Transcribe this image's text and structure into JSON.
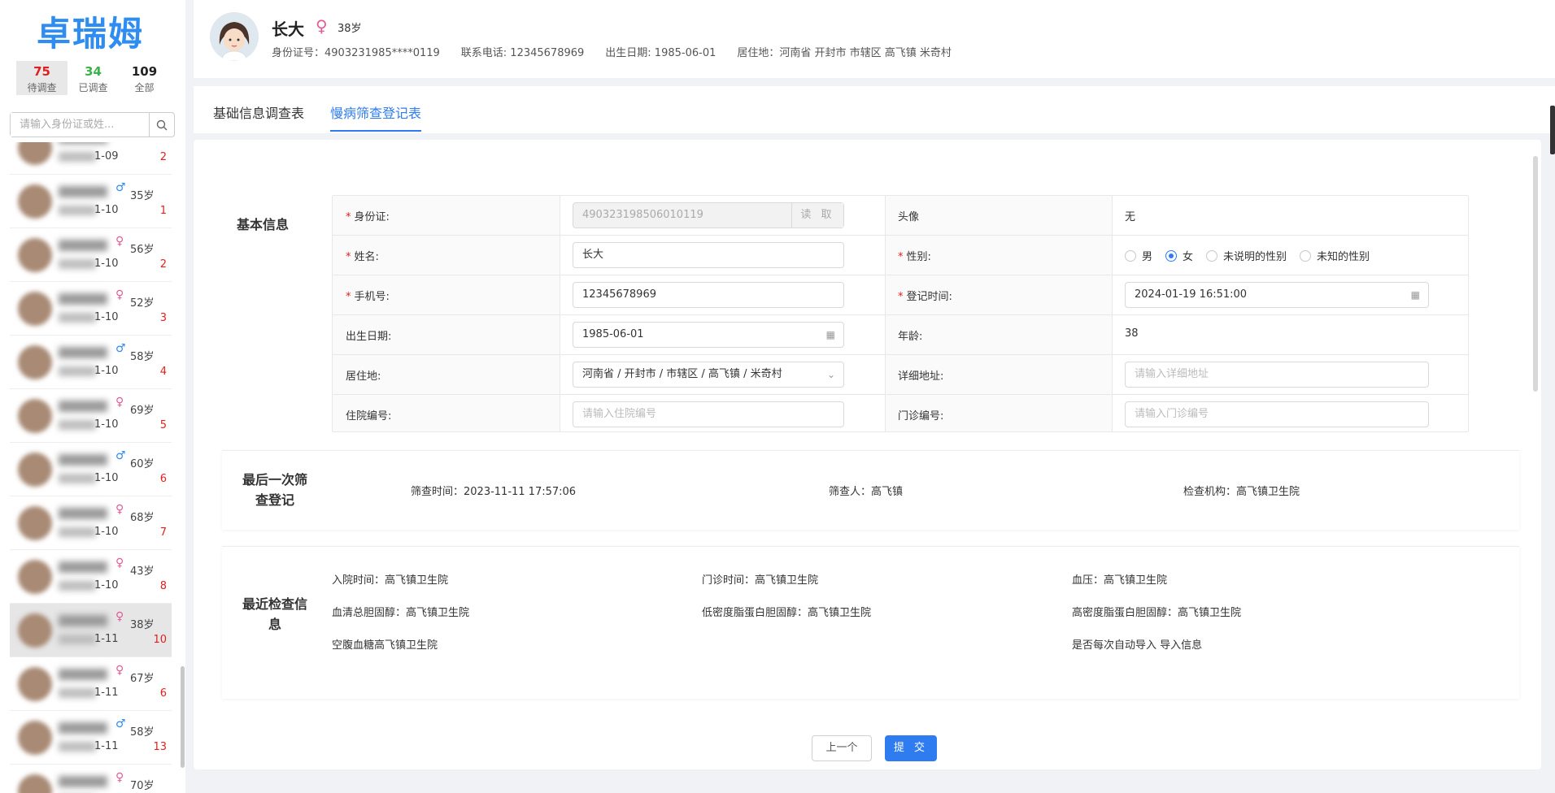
{
  "app": {
    "logo": "卓瑞姆"
  },
  "stats": [
    {
      "num": "75",
      "label": "待调查",
      "color": "#e02020"
    },
    {
      "num": "34",
      "label": "已调查",
      "color": "#3cb34a"
    },
    {
      "num": "109",
      "label": "全部",
      "color": "#222222"
    }
  ],
  "search": {
    "placeholder": "请输入身份证或姓..."
  },
  "people": [
    {
      "date": "1-09",
      "gender": "",
      "age": "",
      "count": "2"
    },
    {
      "date": "1-10",
      "gender": "♂",
      "age": "35岁",
      "count": "1"
    },
    {
      "date": "1-10",
      "gender": "♀",
      "age": "56岁",
      "count": "2"
    },
    {
      "date": "1-10",
      "gender": "♀",
      "age": "52岁",
      "count": "3"
    },
    {
      "date": "1-10",
      "gender": "♂",
      "age": "58岁",
      "count": "4"
    },
    {
      "date": "1-10",
      "gender": "♀",
      "age": "69岁",
      "count": "5"
    },
    {
      "date": "1-10",
      "gender": "♂",
      "age": "60岁",
      "count": "6"
    },
    {
      "date": "1-10",
      "gender": "♀",
      "age": "68岁",
      "count": "7"
    },
    {
      "date": "1-10",
      "gender": "♀",
      "age": "43岁",
      "count": "8"
    },
    {
      "date": "1-11",
      "gender": "♀",
      "age": "38岁",
      "count": "10",
      "selected": true
    },
    {
      "date": "1-11",
      "gender": "♀",
      "age": "67岁",
      "count": "6"
    },
    {
      "date": "1-11",
      "gender": "♂",
      "age": "58岁",
      "count": "13"
    },
    {
      "date": "",
      "gender": "♀",
      "age": "70岁",
      "count": ""
    }
  ],
  "header": {
    "name": "长大",
    "gender": "♀",
    "age": "38岁",
    "id_text": "身份证号：4903231985****0119",
    "phone_text": "联系电话: 12345678969",
    "birth_text": "出生日期: 1985-06-01",
    "address_text": "居住地：河南省 开封市 市辖区 高飞镇 米奇村"
  },
  "tabs": [
    {
      "label": "基础信息调查表",
      "active": false
    },
    {
      "label": "慢病筛查登记表",
      "active": true
    }
  ],
  "basic": {
    "title": "基本信息",
    "id_label": "身份证:",
    "id_value": "490323198506010119",
    "read_btn": "读 取",
    "avatar_label": "头像",
    "avatar_value": "无",
    "name_label": "姓名:",
    "name_value": "长大",
    "gender_label": "性别:",
    "gender_options": [
      "男",
      "女",
      "未说明的性别",
      "未知的性别"
    ],
    "gender_selected": "女",
    "phone_label": "手机号:",
    "phone_value": "12345678969",
    "reg_time_label": "登记时间:",
    "reg_time_value": "2024-01-19 16:51:00",
    "birth_label": "出生日期:",
    "birth_value": "1985-06-01",
    "age_label": "年龄:",
    "age_value": "38",
    "residence_label": "居住地:",
    "residence_value": "河南省 / 开封市 / 市辖区 / 高飞镇 / 米奇村",
    "addr_label": "详细地址:",
    "addr_placeholder": "请输入详细地址",
    "inpatient_label": "住院编号:",
    "inpatient_placeholder": "请输入住院编号",
    "outpatient_label": "门诊编号:",
    "outpatient_placeholder": "请输入门诊编号"
  },
  "last_screening": {
    "title": "最后一次筛查登记",
    "time": "筛查时间：2023-11-11 17:57:06",
    "person": "筛查人：高飞镇",
    "org": "检查机构：高飞镇卫生院"
  },
  "recent_check": {
    "title": "最近检查信息",
    "items": [
      "入院时间：高飞镇卫生院",
      "门诊时间：高飞镇卫生院",
      "血压：高飞镇卫生院",
      "血清总胆固醇：高飞镇卫生院",
      "低密度脂蛋白胆固醇：高飞镇卫生院",
      "高密度脂蛋白胆固醇：高飞镇卫生院",
      "空腹血糖高飞镇卫生院",
      "是否每次自动导入 导入信息"
    ]
  },
  "buttons": {
    "prev": "上一个",
    "submit": "提 交"
  },
  "colors": {
    "primary": "#2f7cf0",
    "danger": "#e02020",
    "success": "#3cb34a",
    "female": "#e05c9a",
    "male": "#2f8cf0"
  }
}
